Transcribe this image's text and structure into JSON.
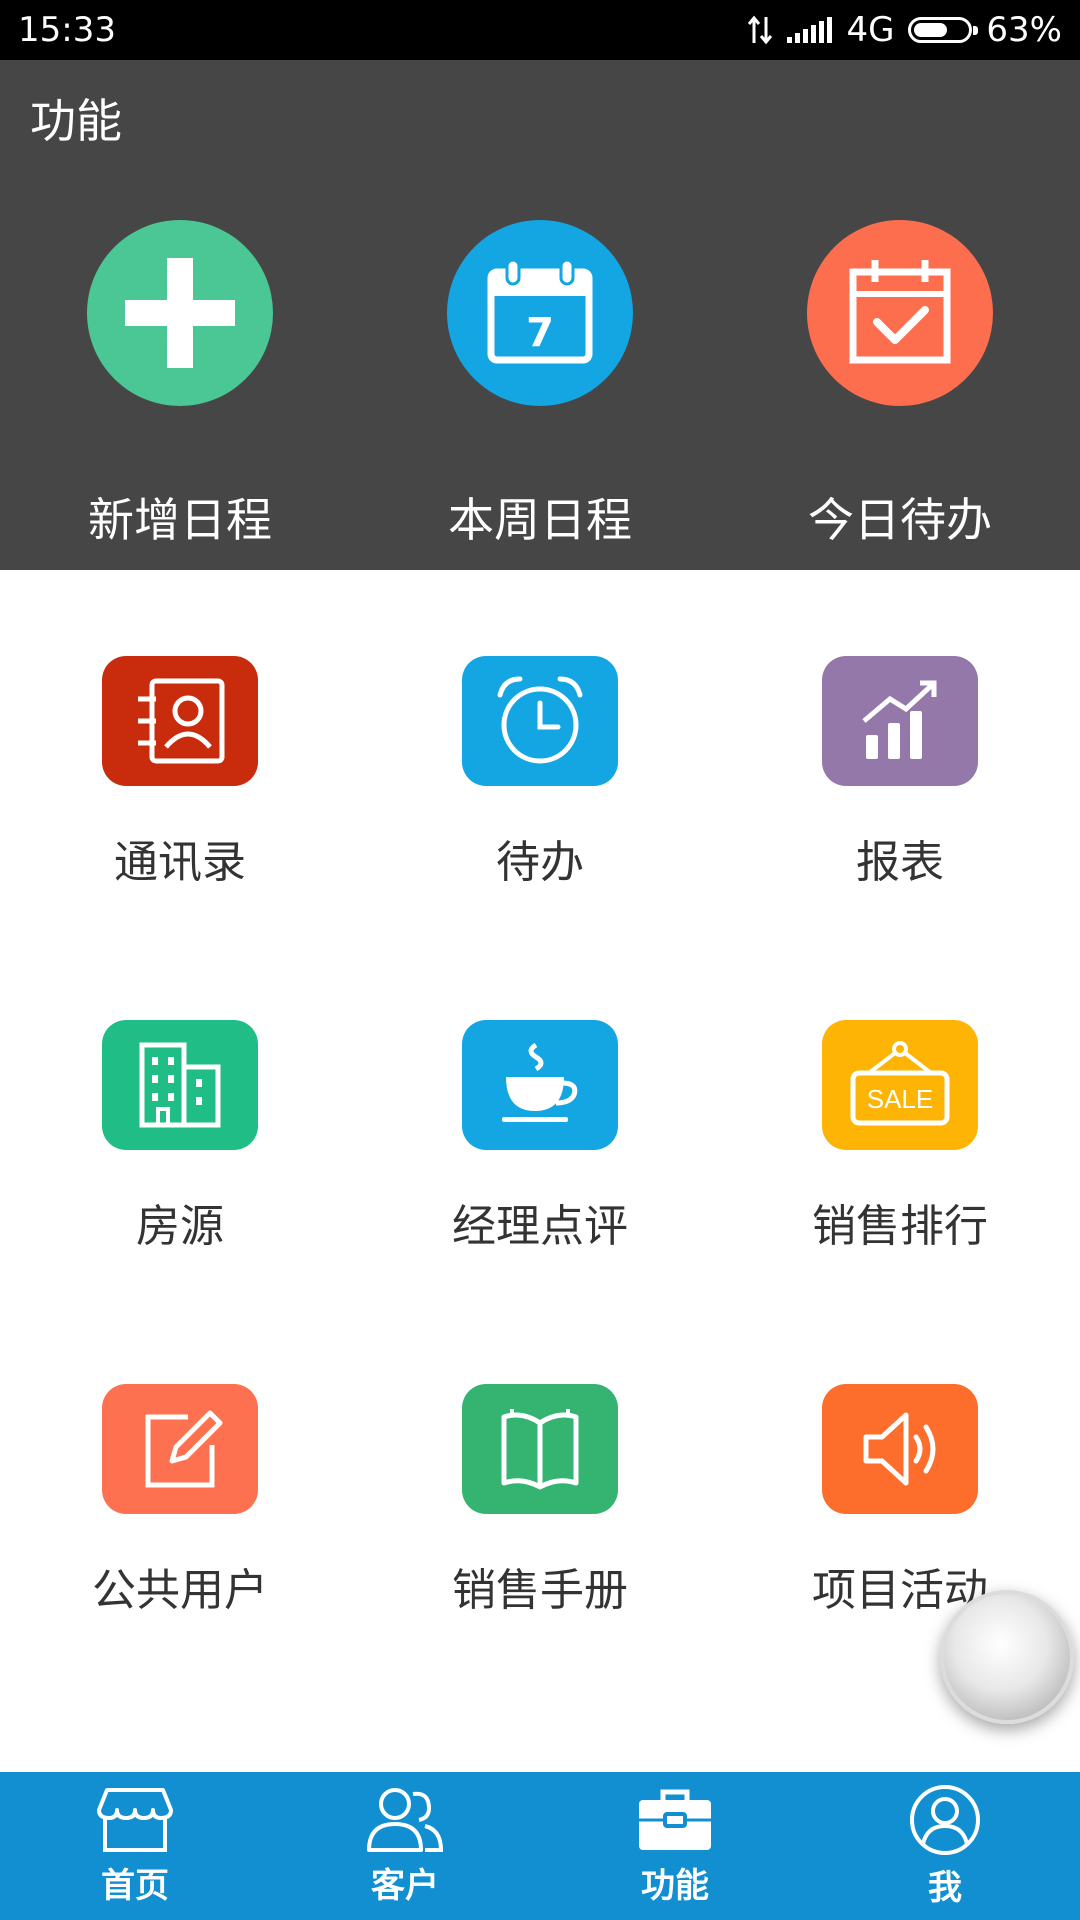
{
  "status_bar": {
    "time": "15:33",
    "network": "4G",
    "battery": "63%",
    "battery_level": 0.63
  },
  "header": {
    "title": "功能"
  },
  "quick_actions": [
    {
      "label": "新增日程",
      "icon": "plus-icon",
      "color": "#4bc796"
    },
    {
      "label": "本周日程",
      "icon": "calendar-icon",
      "color": "#13a6e3",
      "calendar_day": "7"
    },
    {
      "label": "今日待办",
      "icon": "calendar-check-icon",
      "color": "#fc6e4e"
    }
  ],
  "grid": [
    {
      "label": "通讯录",
      "icon": "contacts-icon",
      "color": "#c92c0c"
    },
    {
      "label": "待办",
      "icon": "alarm-clock-icon",
      "color": "#13a6e3"
    },
    {
      "label": "报表",
      "icon": "chart-icon",
      "color": "#9378a9"
    },
    {
      "label": "房源",
      "icon": "building-icon",
      "color": "#21bd86"
    },
    {
      "label": "经理点评",
      "icon": "coffee-cup-icon",
      "color": "#13a6e3"
    },
    {
      "label": "销售排行",
      "icon": "sale-sign-icon",
      "color": "#fdb404",
      "sign_text": "SALE"
    },
    {
      "label": "公共用户",
      "icon": "edit-icon",
      "color": "#fd7150"
    },
    {
      "label": "销售手册",
      "icon": "book-icon",
      "color": "#35b370"
    },
    {
      "label": "项目活动",
      "icon": "speaker-icon",
      "color": "#fd6d2c"
    }
  ],
  "bottom_nav": [
    {
      "label": "首页",
      "icon": "store-icon"
    },
    {
      "label": "客户",
      "icon": "customers-icon"
    },
    {
      "label": "功能",
      "icon": "toolbox-icon",
      "active": true
    },
    {
      "label": "我",
      "icon": "user-icon"
    }
  ],
  "colors": {
    "header_bg": "#464646",
    "nav_bg": "#128fd1",
    "status_bg": "#000000"
  }
}
